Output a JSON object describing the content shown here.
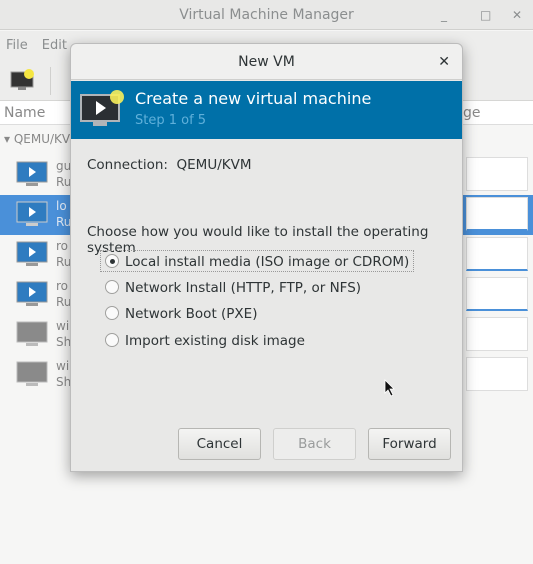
{
  "window": {
    "title": "Virtual Machine Manager",
    "minimize": "_",
    "maximize": "□",
    "close": "✕"
  },
  "menu": {
    "file": "File",
    "edit": "Edit"
  },
  "list": {
    "name_header": "Name",
    "usage_header_partial": "ge",
    "connection": "QEMU/KVM",
    "vms": [
      {
        "name": "gu",
        "status": "Ru",
        "state": "running"
      },
      {
        "name": "lo",
        "status": "Ru",
        "state": "running",
        "selected": true
      },
      {
        "name": "ro",
        "status": "Ru",
        "state": "running"
      },
      {
        "name": "ro",
        "status": "Ru",
        "state": "running"
      },
      {
        "name": "wi",
        "status": "Sh",
        "state": "shutoff"
      },
      {
        "name": "wi",
        "status": "Sh",
        "state": "shutoff"
      }
    ]
  },
  "dialog": {
    "title": "New VM",
    "close": "✕",
    "banner_title": "Create a new virtual machine",
    "banner_step": "Step 1 of 5",
    "connection_label": "Connection:",
    "connection_value": "QEMU/KVM",
    "prompt": "Choose how you would like to install the operating system",
    "options": [
      {
        "label": "Local install media (ISO image or CDROM)",
        "selected": true
      },
      {
        "label": "Network Install (HTTP, FTP, or NFS)",
        "selected": false
      },
      {
        "label": "Network Boot (PXE)",
        "selected": false
      },
      {
        "label": "Import existing disk image",
        "selected": false
      }
    ],
    "cancel": "Cancel",
    "back": "Back",
    "forward": "Forward"
  },
  "colors": {
    "banner": "#0070a8",
    "selection": "#4a90d9"
  }
}
